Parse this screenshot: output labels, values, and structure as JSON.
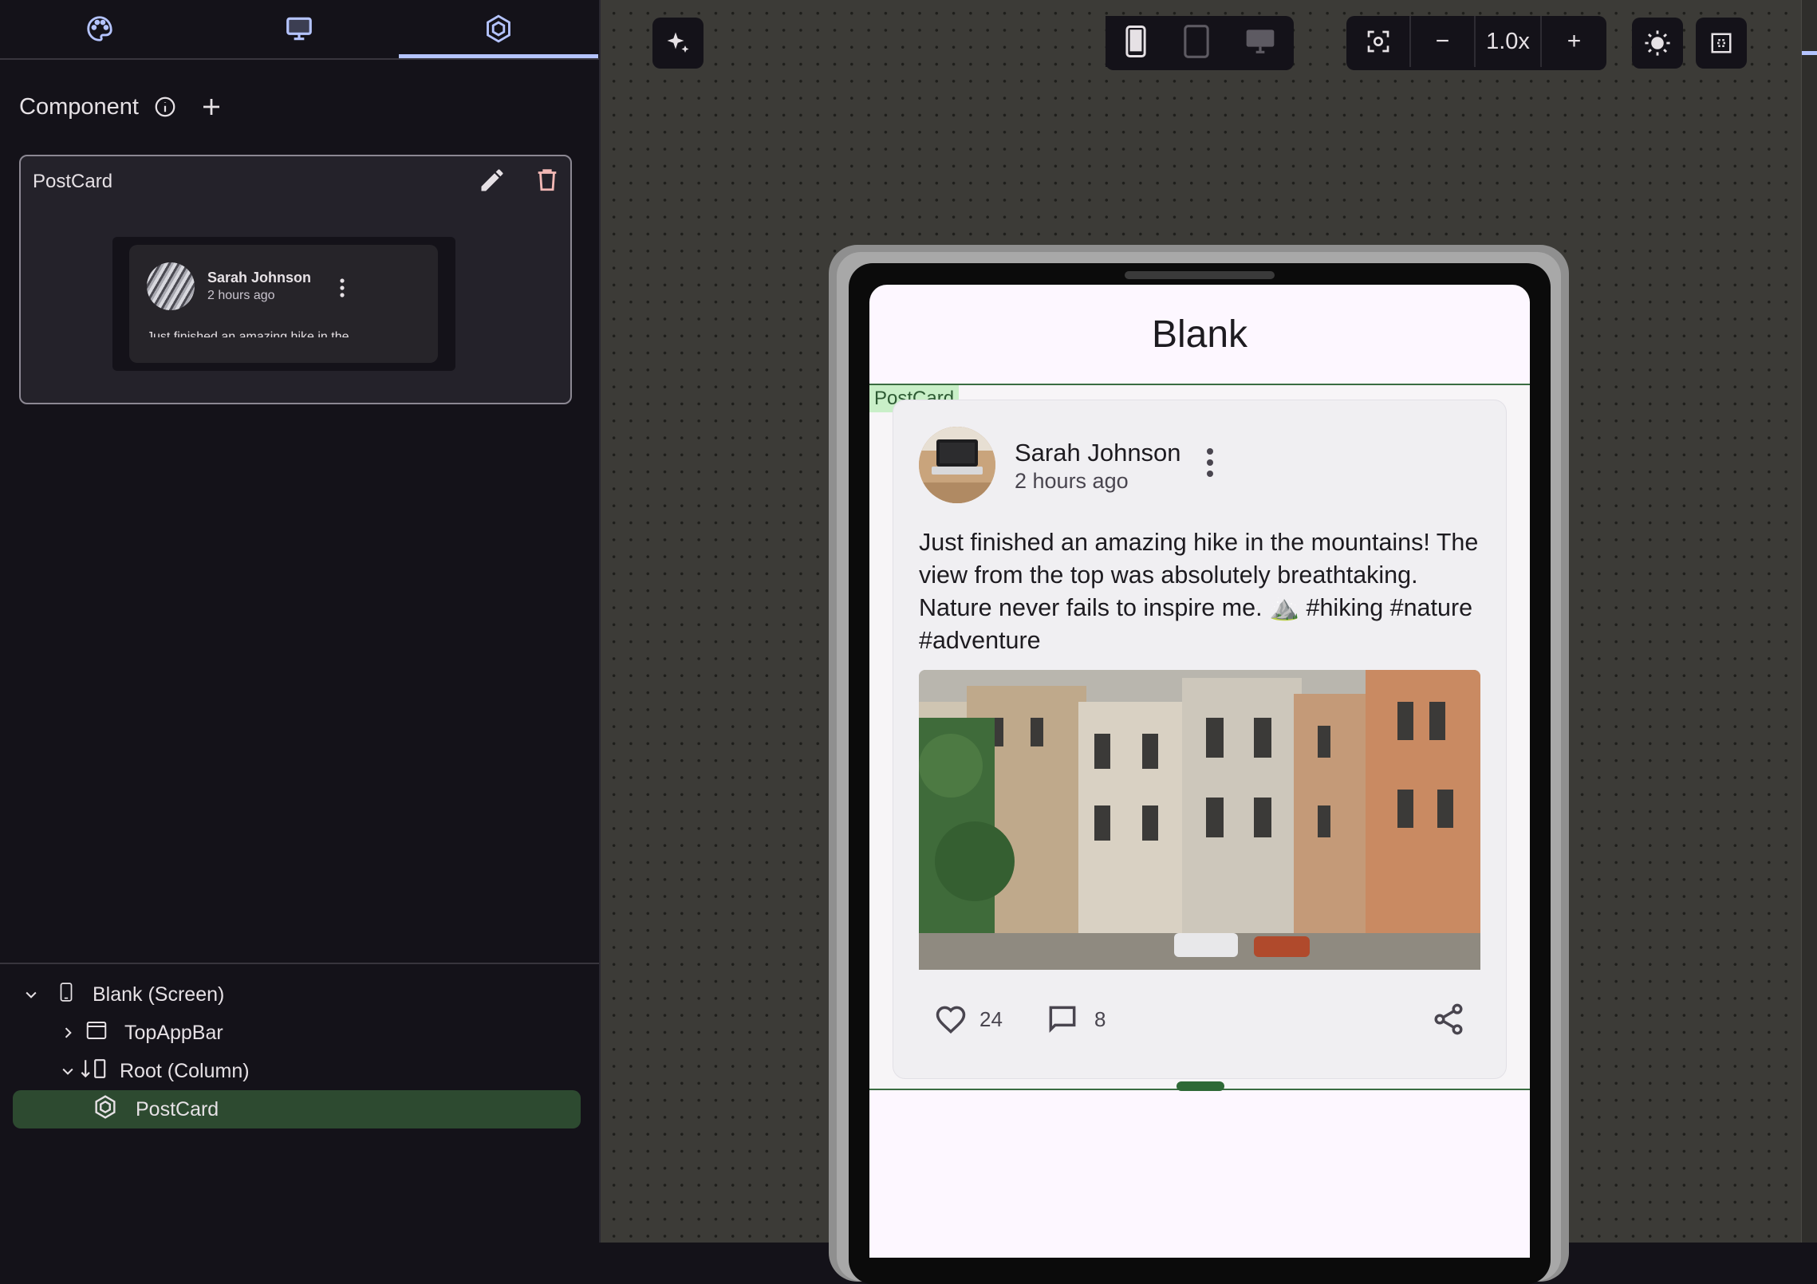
{
  "left_panel": {
    "tabs": [
      {
        "icon": "palette-icon",
        "active": false
      },
      {
        "icon": "monitor-icon",
        "active": false
      },
      {
        "icon": "component-icon",
        "active": true
      }
    ],
    "component_header": {
      "title": "Component"
    },
    "component_card": {
      "name": "PostCard",
      "preview": {
        "author": "Sarah Johnson",
        "time": "2 hours ago",
        "body": "Just finished an amazing hike in the"
      }
    },
    "tree": [
      {
        "label": "Blank (Screen)",
        "icon": "phone-icon",
        "expanded": true
      },
      {
        "label": "TopAppBar",
        "icon": "window-icon",
        "expanded": false
      },
      {
        "label": "Root (Column)",
        "icon": "column-icon",
        "expanded": true
      },
      {
        "label": "PostCard",
        "icon": "component-icon",
        "selected": true
      }
    ]
  },
  "toolbar": {
    "devices": [
      "phone-icon",
      "tablet-icon",
      "desktop-icon"
    ],
    "selected_device": "phone",
    "zoom": {
      "minus": "−",
      "value": "1.0x",
      "plus": "+"
    }
  },
  "screen": {
    "app_title": "Blank",
    "component_tag": "PostCard",
    "post": {
      "author": "Sarah Johnson",
      "time": "2 hours ago",
      "body": "Just finished an amazing hike in the mountains! The view from the top was absolutely breathtaking. Nature never fails to inspire me. ⛰️ #hiking #nature #adventure",
      "likes": "24",
      "comments": "8"
    }
  },
  "colors": {
    "accent": "#b5c4ff",
    "selection": "#2d4a30",
    "outline_green": "#3a6d41",
    "delete": "#f2b8b5"
  }
}
